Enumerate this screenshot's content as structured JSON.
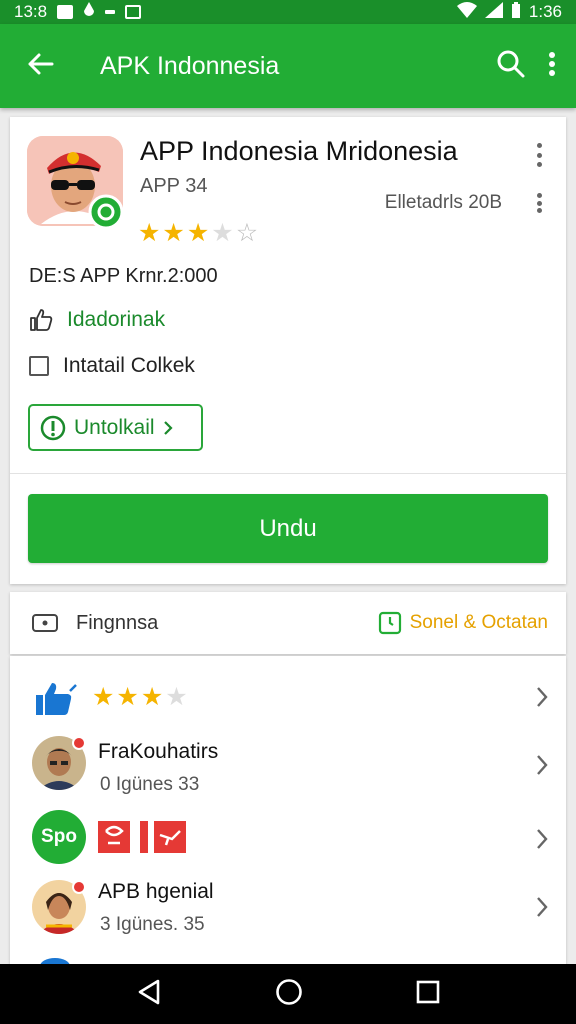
{
  "status_bar": {
    "time_left": "13:8",
    "time_right": "1:36"
  },
  "app_bar": {
    "title": "APK Indonnesia"
  },
  "app": {
    "name": "APP Indonesia Mridonesia",
    "version": "APP 34",
    "meta": "Elletadrls 20B",
    "rating": 3,
    "rating_max": 5,
    "description": "DE:S APP Krnr.2:000",
    "like_label": "Idadorinak",
    "checkbox_label": "Intatail Colkek",
    "outline_button_label": "Untolkail",
    "primary_button_label": "Undu"
  },
  "section": {
    "title": "Fingnnsa",
    "link_label": "Sonel & Octatan"
  },
  "list": {
    "rows": [
      {
        "title": "",
        "rating": 3
      },
      {
        "title": "FraKouhatirs",
        "subtitle": "0  Igünes 33"
      },
      {
        "title": "Spo",
        "subtitle": ""
      },
      {
        "title": "APB hgenial",
        "subtitle": "3  Igünes. 35"
      }
    ]
  },
  "colors": {
    "primary": "#22ad35",
    "primary_dark": "#1a8f2a",
    "accent": "#e5a100",
    "star": "#f5b400"
  },
  "icons": [
    "back-arrow-icon",
    "search-icon",
    "more-vert-icon",
    "thumb-up-icon",
    "checkbox-icon",
    "info-icon",
    "chevron-right-icon",
    "clock-icon",
    "nav-back-icon",
    "nav-home-icon",
    "nav-recents-icon"
  ]
}
